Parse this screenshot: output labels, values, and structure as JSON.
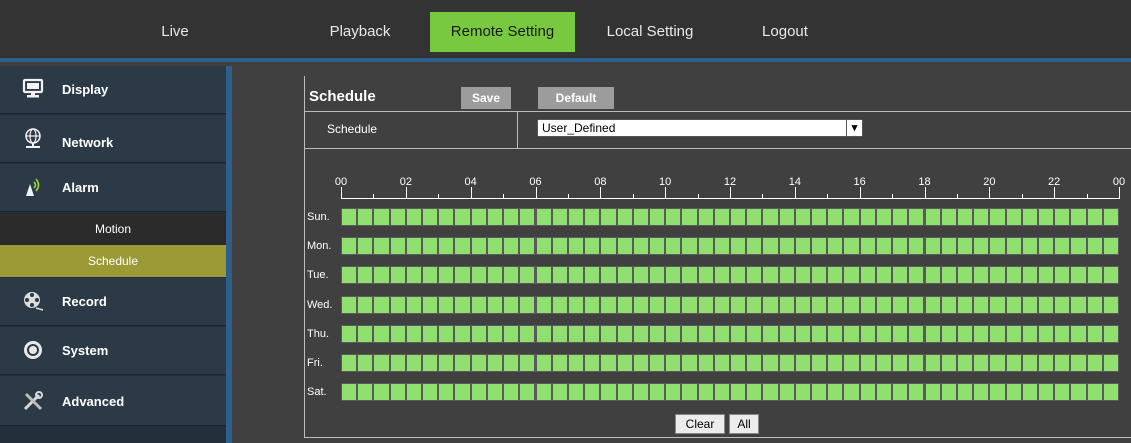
{
  "nav": {
    "live": "Live",
    "playback": "Playback",
    "remote_setting": "Remote Setting",
    "local_setting": "Local Setting",
    "logout": "Logout",
    "active_color": "#78c93f"
  },
  "sidebar": {
    "items": [
      {
        "label": "Display",
        "icon": "monitor-icon"
      },
      {
        "label": "Network",
        "icon": "globe-network-icon"
      },
      {
        "label": "Alarm",
        "icon": "alarm-icon"
      },
      {
        "label": "Record",
        "icon": "film-reel-icon"
      },
      {
        "label": "System",
        "icon": "gear-icon"
      },
      {
        "label": "Advanced",
        "icon": "tools-icon"
      }
    ],
    "sub_items": [
      {
        "label": "Motion"
      },
      {
        "label": "Schedule",
        "active": true
      }
    ],
    "active_color": "#9b9a36"
  },
  "main": {
    "title": "Schedule",
    "save_label": "Save",
    "default_label": "Default",
    "schedule_label": "Schedule",
    "schedule_value": "User_Defined",
    "hour_labels": [
      "00",
      "02",
      "04",
      "06",
      "08",
      "10",
      "12",
      "14",
      "16",
      "18",
      "20",
      "22",
      "00"
    ],
    "days": [
      "Sun.",
      "Mon.",
      "Tue.",
      "Wed.",
      "Thu.",
      "Fri.",
      "Sat."
    ],
    "cells_per_day": 48,
    "cell_color": "#90e070",
    "clear_label": "Clear",
    "all_label": "All"
  }
}
